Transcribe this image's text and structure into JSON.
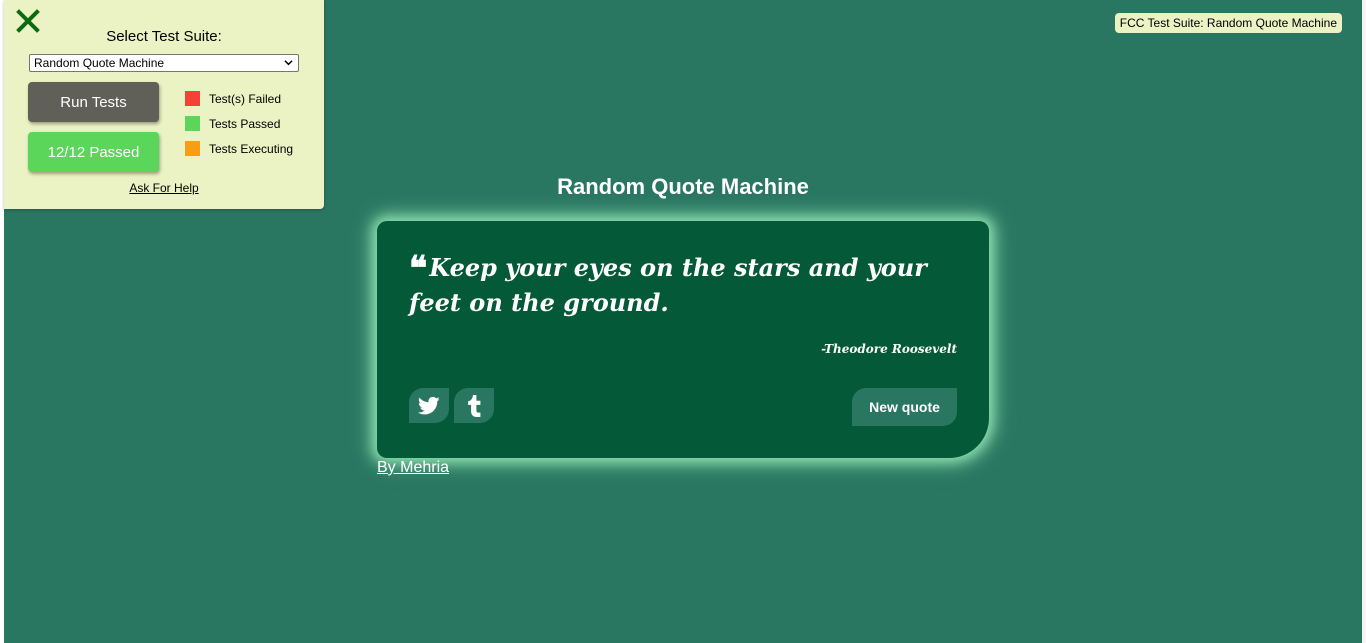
{
  "fcc_panel": {
    "close_icon": "close-icon",
    "select_label": "Select Test Suite:",
    "selected_suite": "Random Quote Machine",
    "run_tests_label": "Run Tests",
    "passed_label": "12/12 Passed",
    "legend": [
      {
        "label": "Test(s) Failed",
        "color": "#f44336"
      },
      {
        "label": "Tests Passed",
        "color": "#5bd65b"
      },
      {
        "label": "Tests Executing",
        "color": "#f89e15"
      }
    ],
    "help_link": "Ask For Help",
    "badge": "FCC Test Suite: Random Quote Machine"
  },
  "app": {
    "title": "Random Quote Machine",
    "quote_text": "Keep your eyes on the stars and your feet on the ground.",
    "quote_author": "-Theodore Roosevelt",
    "tweet_icon": "twitter-icon",
    "tumblr_icon": "tumblr-icon",
    "new_quote_label": "New quote",
    "credit_link": "By Mehria"
  },
  "colors": {
    "background": "#297661",
    "quote_box": "#045a38",
    "panel": "#ebf2c4",
    "glow": "#8de0b0"
  }
}
